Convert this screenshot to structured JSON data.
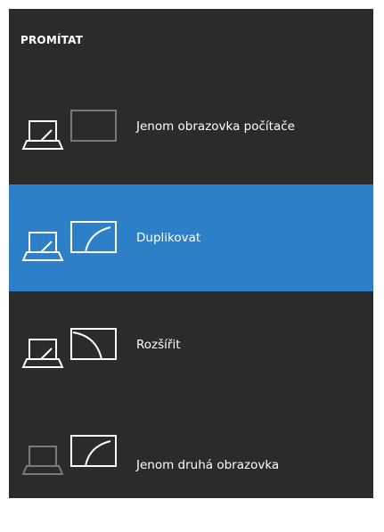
{
  "panel": {
    "title": "PROMÍTAT",
    "colors": {
      "background": "#2b2b2b",
      "accent": "#2d7fc8",
      "icon_active": "#ffffff",
      "icon_inactive": "#7a7a7a"
    }
  },
  "options": [
    {
      "label": "Jenom obrazovka počítače",
      "icon": "pc-screen-only-icon",
      "selected": false
    },
    {
      "label": "Duplikovat",
      "icon": "duplicate-icon",
      "selected": true
    },
    {
      "label": "Rozšířit",
      "icon": "extend-icon",
      "selected": false
    },
    {
      "label": "Jenom druhá obrazovka",
      "icon": "second-screen-only-icon",
      "selected": false
    }
  ]
}
